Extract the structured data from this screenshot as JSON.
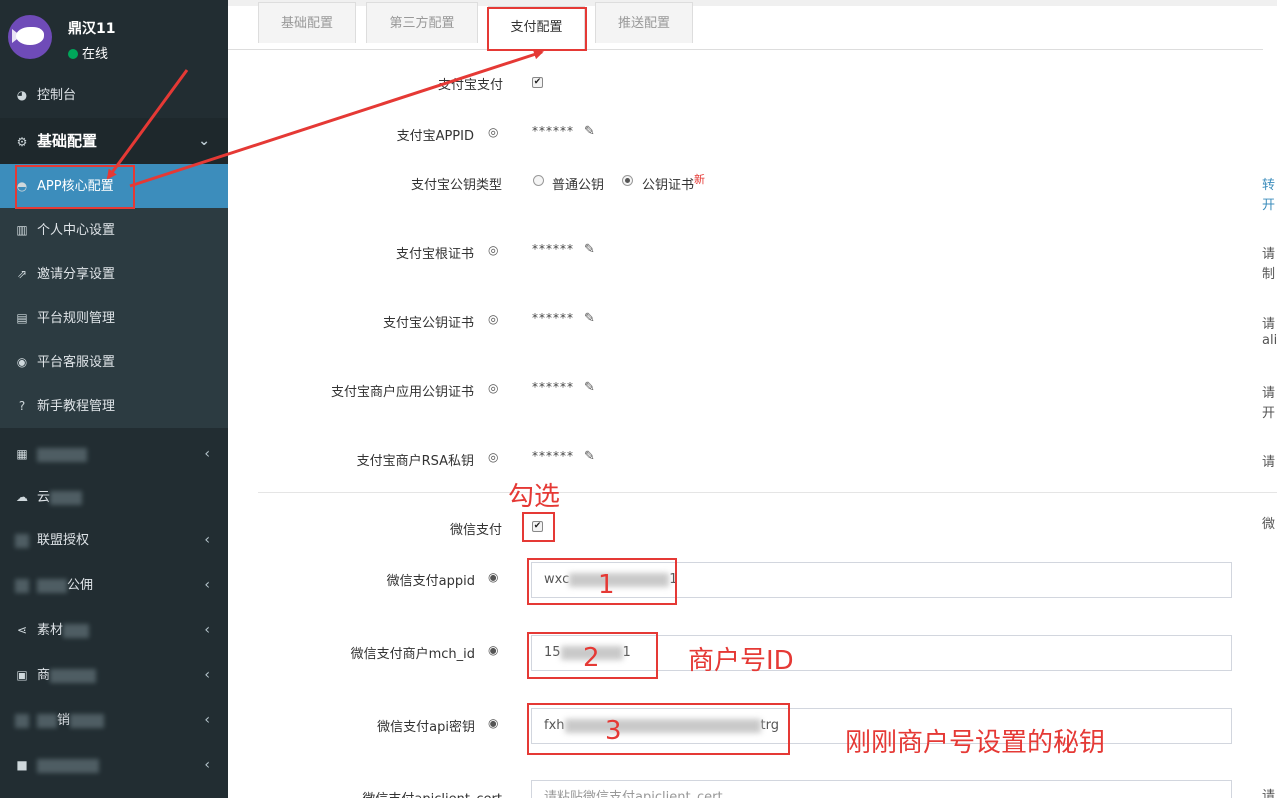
{
  "user": {
    "name": "鼎汉11",
    "status": "在线"
  },
  "sidebar": {
    "dashboard": "控制台",
    "base_config": "基础配置",
    "items": [
      "APP核心配置",
      "个人中心设置",
      "邀请分享设置",
      "平台规则管理",
      "平台客服设置",
      "新手教程管理"
    ],
    "collapsed": [
      {
        "label": "",
        "icon": "grid-icon"
      },
      {
        "label": "云",
        "icon": "cloud-icon"
      },
      {
        "label": "联盟授权",
        "icon": "chain-icon"
      },
      {
        "label": "公佣",
        "icon": "coin-icon"
      },
      {
        "label": "素材",
        "icon": "share-icon"
      },
      {
        "label": "商",
        "icon": "briefcase-icon"
      },
      {
        "label": "销",
        "icon": "settings-icon"
      },
      {
        "label": "",
        "icon": "video-icon"
      }
    ]
  },
  "tabs": [
    "基础配置",
    "第三方配置",
    "支付配置",
    "推送配置"
  ],
  "form": {
    "alipay_enable": "支付宝支付",
    "alipay_appid": "支付宝APPID",
    "alipay_key_type": "支付宝公钥类型",
    "key_type_options": [
      "普通公钥",
      "公钥证书"
    ],
    "new_badge": "新",
    "alipay_root_cert": "支付宝根证书",
    "alipay_public_cert": "支付宝公钥证书",
    "alipay_app_cert": "支付宝商户应用公钥证书",
    "alipay_rsa_key": "支付宝商户RSA私钥",
    "masked": "******",
    "wechat_enable": "微信支付",
    "wechat_appid": "微信支付appid",
    "wechat_mchid": "微信支付商户mch_id",
    "wechat_api_key": "微信支付api密钥",
    "wechat_cert": "微信支付apiclient_cert",
    "appid_value_start": "wxc",
    "appid_value_end": "1",
    "mchid_value_start": "15",
    "mchid_value_end": "1",
    "api_key_start": "fxh",
    "api_key_end": "trg",
    "cert_placeholder": "请粘贴微信支付apiclient_cert"
  },
  "right_hints": [
    "转",
    "开",
    "请",
    "制",
    "请",
    "ali",
    "请",
    "开",
    "请",
    "微",
    "请"
  ],
  "annotations": {
    "check": "勾选",
    "n1": "1",
    "n2": "2",
    "n3": "3",
    "mchid": "商户号ID",
    "secret": "刚刚商户号设置的秘钥",
    "color": "#e53935"
  }
}
